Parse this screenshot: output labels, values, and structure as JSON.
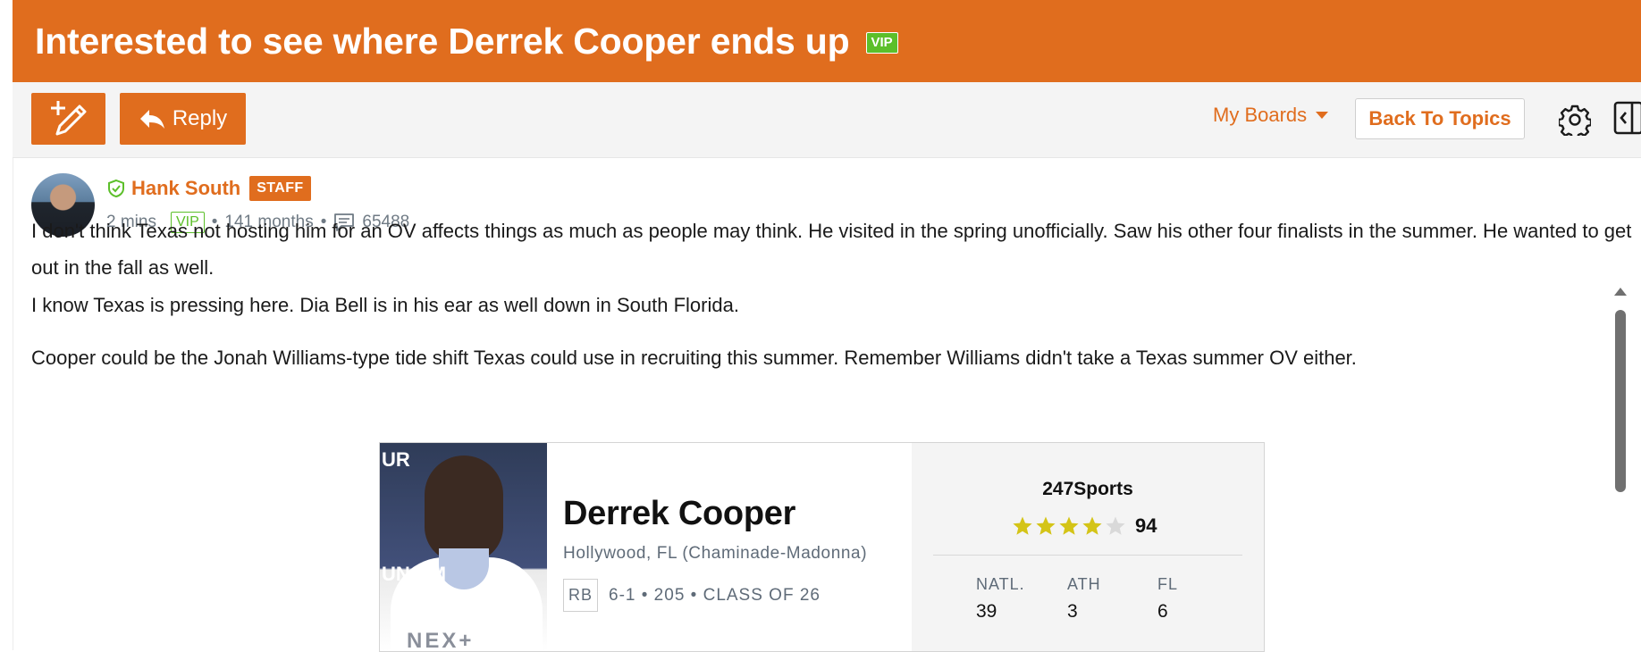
{
  "topic": {
    "title": "Interested to see where Derrek Cooper ends up",
    "vip_label": "VIP"
  },
  "toolbar": {
    "reply_label": "Reply",
    "my_boards_label": "My Boards",
    "back_label": "Back To Topics"
  },
  "post": {
    "author": "Hank South",
    "staff_label": "STAFF",
    "time_ago": "2 mins",
    "vip_label": "VIP",
    "tenure": "141 months",
    "post_count": "65488",
    "paragraphs": [
      "I don't think Texas not hosting him for an OV affects things as much as people may think. He visited in the spring unofficially. Saw his other four finalists in the summer. He wanted to get out in the fall as well.",
      "I know Texas is pressing here. Dia Bell is in his ear as well down in South Florida.",
      "Cooper could be the Jonah Williams-type tide shift Texas could use in recruiting this summer. Remember Williams didn't take a Texas summer OV either."
    ]
  },
  "recruit_card": {
    "name": "Derrek Cooper",
    "school": "Hollywood, FL (Chaminade-Madonna)",
    "position": "RB",
    "details": "6-1 • 205 • CLASS OF 26",
    "photo_text": {
      "top": "UR",
      "middle": "UN    RM",
      "bottom": "NEX+"
    },
    "service": "247Sports",
    "stars": 4,
    "max_stars": 5,
    "score": "94",
    "ranks": [
      {
        "label": "NATL.",
        "value": "39"
      },
      {
        "label": "ATH",
        "value": "3"
      },
      {
        "label": "FL",
        "value": "6"
      }
    ]
  },
  "colors": {
    "brand": "#e06d1e",
    "vip_green": "#5cbf2a",
    "star_gold": "#d4c417",
    "star_empty": "#d9d9d9"
  },
  "icons": [
    "new-topic-pencil-icon",
    "reply-arrow-icon",
    "caret-down-icon",
    "gear-icon",
    "collapse-panel-icon",
    "verified-shield-icon",
    "comment-icon",
    "star-icon"
  ]
}
